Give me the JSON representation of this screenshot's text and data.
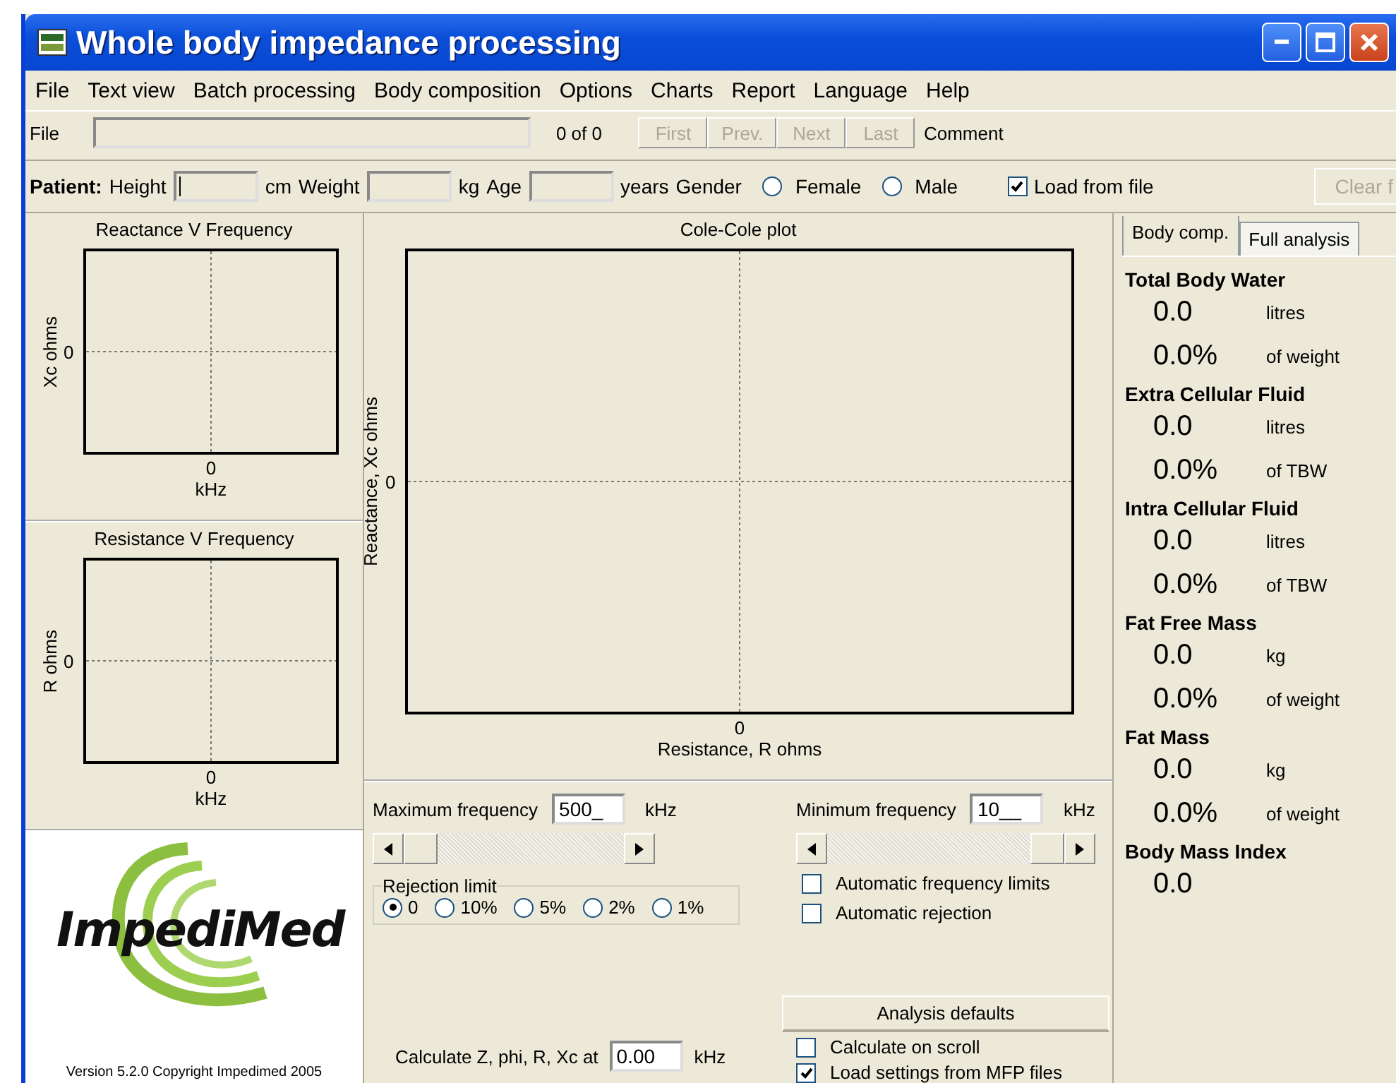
{
  "window": {
    "title": "Whole body impedance processing"
  },
  "menu": [
    "File",
    "Text view",
    "Batch processing",
    "Body composition",
    "Options",
    "Charts",
    "Report",
    "Language",
    "Help"
  ],
  "file_bar": {
    "label": "File",
    "count": "0 of 0",
    "nav": [
      {
        "label": "First",
        "disabled": true
      },
      {
        "label": "Prev.",
        "disabled": true
      },
      {
        "label": "Next",
        "disabled": true
      },
      {
        "label": "Last",
        "disabled": true
      }
    ],
    "comment_label": "Comment"
  },
  "patient": {
    "label": "Patient:",
    "height_label": "Height",
    "height_unit": "cm",
    "weight_label": "Weight",
    "weight_unit": "kg",
    "age_label": "Age",
    "age_unit": "years",
    "gender_label": "Gender",
    "genders": [
      {
        "label": "Female",
        "selected": false
      },
      {
        "label": "Male",
        "selected": false
      }
    ],
    "load_from_file": {
      "label": "Load from file",
      "checked": true
    },
    "clear_button": "Clear f"
  },
  "left_plots": [
    {
      "title": "Reactance V Frequency",
      "ylabel": "Xc ohms",
      "ytick": "0",
      "xtick": "0",
      "xlabel": "kHz"
    },
    {
      "title": "Resistance V Frequency",
      "ylabel": "R ohms",
      "ytick": "0",
      "xtick": "0",
      "xlabel": "kHz"
    }
  ],
  "logo": {
    "name": "ImpediMed",
    "version": "Version 5.2.0  Copyright Impedimed 2005"
  },
  "main_plot": {
    "title": "Cole-Cole plot",
    "ylabel": "Reactance, Xc ohms",
    "ytick": "0",
    "xtick": "0",
    "xlabel": "Resistance, R ohms"
  },
  "controls": {
    "max_freq": {
      "label": "Maximum frequency",
      "value": "500_",
      "unit": "kHz",
      "level": 0
    },
    "min_freq": {
      "label": "Minimum frequency",
      "value": "10__",
      "unit": "kHz",
      "level": 1
    },
    "rejection": {
      "label": "Rejection limit",
      "options": [
        {
          "label": "0",
          "selected": true
        },
        {
          "label": "10%",
          "selected": false
        },
        {
          "label": "5%",
          "selected": false
        },
        {
          "label": "2%",
          "selected": false
        },
        {
          "label": "1%",
          "selected": false
        }
      ]
    },
    "auto_checks": [
      {
        "label": "Automatic frequency limits",
        "checked": false
      },
      {
        "label": "Automatic rejection",
        "checked": false
      }
    ],
    "defaults_button": "Analysis defaults",
    "calc": {
      "label": "Calculate Z, phi, R, Xc at",
      "value": "0.00",
      "unit": "kHz"
    },
    "bottom_checks": [
      {
        "label": "Calculate on scroll",
        "checked": false
      },
      {
        "label": "Load settings from MFP files",
        "checked": true
      }
    ]
  },
  "tabs": [
    {
      "label": "Body comp.",
      "selected": true
    },
    {
      "label": "Full analysis",
      "selected": false
    }
  ],
  "results": [
    {
      "title": "Total Body Water",
      "rows": [
        {
          "value": "0.0",
          "unit": "litres"
        },
        {
          "value": "0.0%",
          "unit": "of weight"
        }
      ]
    },
    {
      "title": "Extra Cellular Fluid",
      "rows": [
        {
          "value": "0.0",
          "unit": "litres"
        },
        {
          "value": "0.0%",
          "unit": "of TBW"
        }
      ]
    },
    {
      "title": "Intra Cellular Fluid",
      "rows": [
        {
          "value": "0.0",
          "unit": "litres"
        },
        {
          "value": "0.0%",
          "unit": "of TBW"
        }
      ]
    },
    {
      "title": "Fat Free Mass",
      "rows": [
        {
          "value": "0.0",
          "unit": "kg"
        },
        {
          "value": "0.0%",
          "unit": "of weight"
        }
      ]
    },
    {
      "title": "Fat Mass",
      "rows": [
        {
          "value": "0.0",
          "unit": "kg"
        },
        {
          "value": "0.0%",
          "unit": "of weight"
        }
      ]
    },
    {
      "title": "Body Mass Index",
      "rows": [
        {
          "value": "0.0"
        }
      ]
    }
  ]
}
